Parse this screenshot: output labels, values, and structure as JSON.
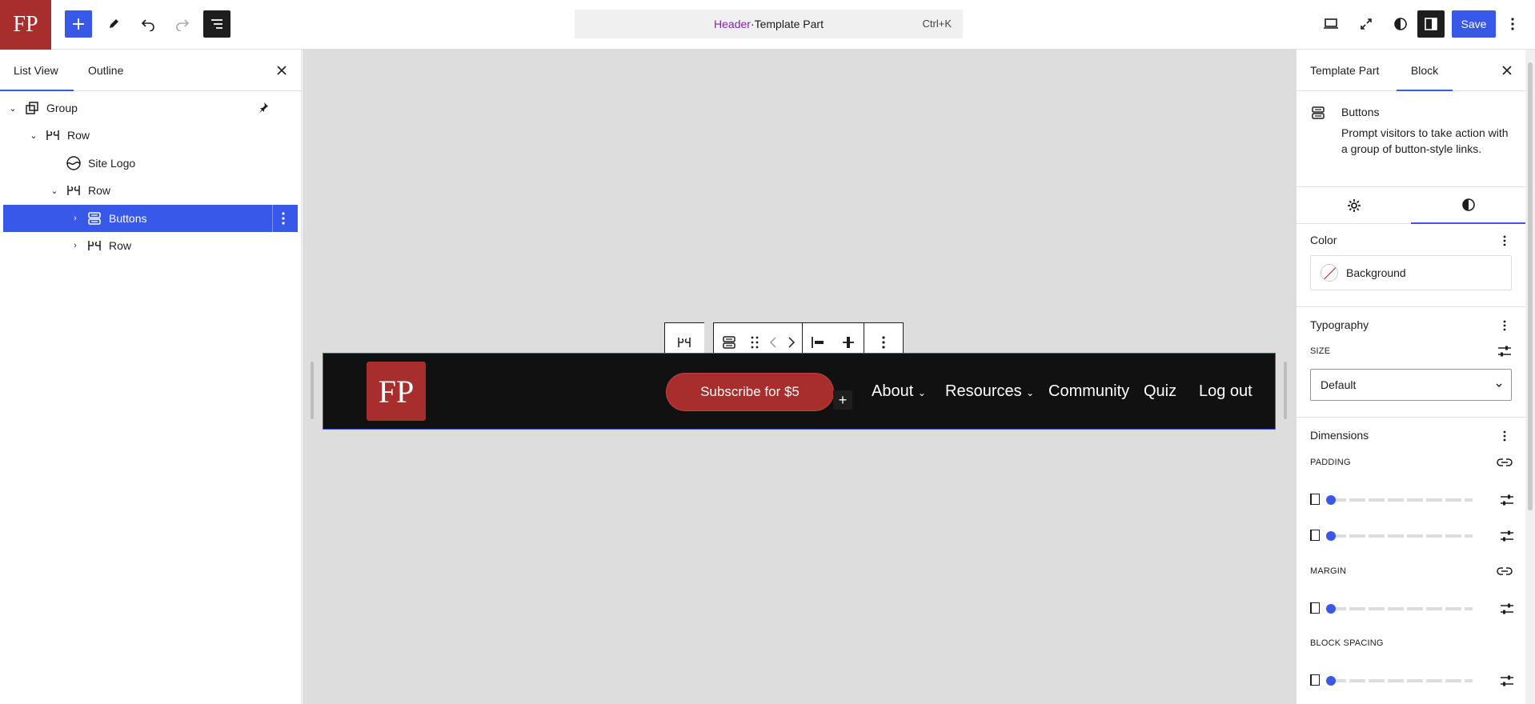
{
  "topbar": {
    "site_logo": "FP",
    "command": {
      "entity": "Header",
      "separator": " · ",
      "type": "Template Part",
      "shortcut": "Ctrl+K"
    },
    "save_label": "Save"
  },
  "list_view": {
    "tabs": [
      {
        "label": "List View"
      },
      {
        "label": "Outline"
      }
    ],
    "items": [
      {
        "label": "Group"
      },
      {
        "label": "Row"
      },
      {
        "label": "Site Logo"
      },
      {
        "label": "Row"
      },
      {
        "label": "Buttons",
        "selected": true
      },
      {
        "label": "Row"
      }
    ]
  },
  "canvas": {
    "logo_text": "FP",
    "subscribe_label": "Subscribe for $5",
    "nav": [
      "About",
      "Resources",
      "Community",
      "Quiz",
      "Log out"
    ]
  },
  "sidebar": {
    "tabs": [
      {
        "label": "Template Part"
      },
      {
        "label": "Block"
      }
    ],
    "block": {
      "name": "Buttons",
      "description": "Prompt visitors to take action with a group of button-style links."
    },
    "color": {
      "title": "Color",
      "background_label": "Background"
    },
    "typography": {
      "title": "Typography",
      "size_label": "SIZE",
      "size_value": "Default"
    },
    "dimensions": {
      "title": "Dimensions",
      "padding_label": "PADDING",
      "margin_label": "MARGIN",
      "block_spacing_label": "BLOCK SPACING"
    }
  },
  "colors": {
    "accent": "#3858e9",
    "brand": "#a82d2d",
    "header_bg": "#111111",
    "canvas_bg": "#dddddd"
  }
}
